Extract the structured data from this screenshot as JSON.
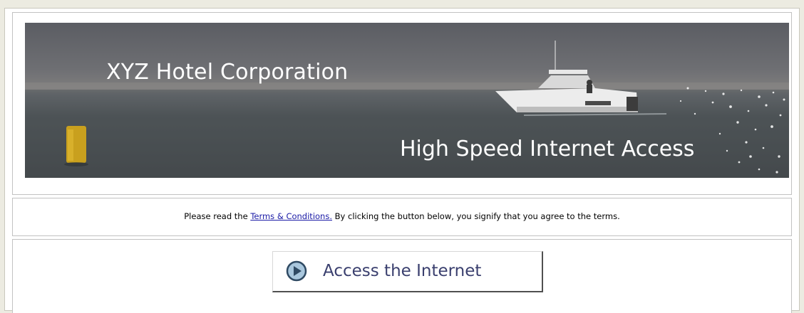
{
  "banner": {
    "company_name": "XYZ Hotel Corporation",
    "subtitle": "High Speed Internet Access"
  },
  "terms": {
    "prefix": "Please read the",
    "link_label": "Terms & Conditions.",
    "suffix": "By clicking the button below, you signify that you agree to the terms."
  },
  "action": {
    "button_label": "Access the Internet",
    "button_icon": "play-circle-icon"
  },
  "colors": {
    "page_background": "#ecebe1",
    "link": "#1a1aa6",
    "button_text": "#3a3f6e",
    "icon_fill": "#a9c7dd",
    "icon_stroke": "#2f4a63"
  }
}
